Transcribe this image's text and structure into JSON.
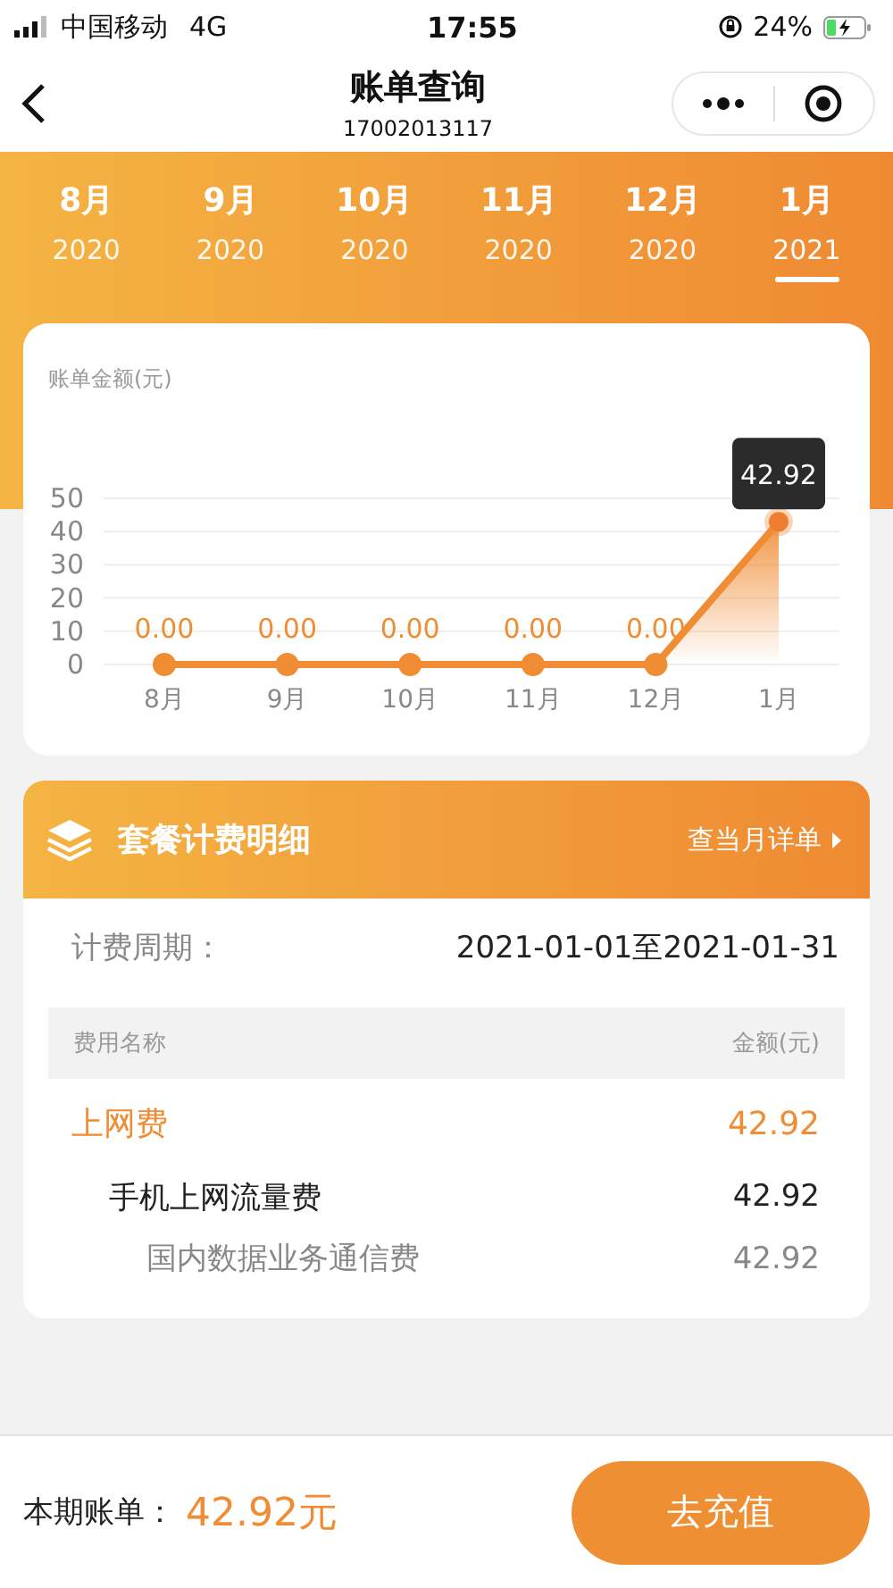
{
  "status_bar": {
    "carrier": "中国移动",
    "network": "4G",
    "time": "17:55",
    "battery": "24%"
  },
  "nav": {
    "title": "账单查询",
    "subtitle": "17002013117"
  },
  "month_tabs": [
    {
      "month": "8月",
      "year": "2020",
      "selected": false
    },
    {
      "month": "9月",
      "year": "2020",
      "selected": false
    },
    {
      "month": "10月",
      "year": "2020",
      "selected": false
    },
    {
      "month": "11月",
      "year": "2020",
      "selected": false
    },
    {
      "month": "12月",
      "year": "2020",
      "selected": false
    },
    {
      "month": "1月",
      "year": "2021",
      "selected": true
    }
  ],
  "bill_chart": {
    "chart_data": {
      "type": "line",
      "ylabel": "账单金额(元)",
      "categories": [
        "8月",
        "9月",
        "10月",
        "11月",
        "12月",
        "1月"
      ],
      "series": [
        {
          "color": "#f08c33",
          "marker": "circle",
          "values": [
            0,
            0,
            0,
            0,
            0,
            42.92
          ]
        }
      ],
      "grid": true,
      "ylim": [
        0,
        50
      ],
      "yticks": [
        0,
        10,
        20,
        30,
        40,
        50
      ],
      "value_labels": [
        "0.00",
        "0.00",
        "0.00",
        "0.00",
        "0.00",
        null
      ],
      "annotations": [
        {
          "x": "1月",
          "y": 42.92,
          "text": "42.92"
        }
      ]
    }
  },
  "package_card": {
    "title": "套餐计费明细",
    "link": "查当月详单",
    "period_label": "计费周期：",
    "period_value": "2021-01-01至2021-01-31",
    "columns": [
      "费用名称",
      "金额(元)"
    ],
    "fees": [
      {
        "name": "上网费",
        "amount": "42.92",
        "children": [
          {
            "name": "手机上网流量费",
            "amount": "42.92",
            "children": [
              {
                "name": "国内数据业务通信费",
                "amount": "42.92"
              }
            ]
          }
        ]
      }
    ]
  },
  "bottom_bar": {
    "label": "本期账单：",
    "amount": "42.92元",
    "button": "去充值"
  }
}
